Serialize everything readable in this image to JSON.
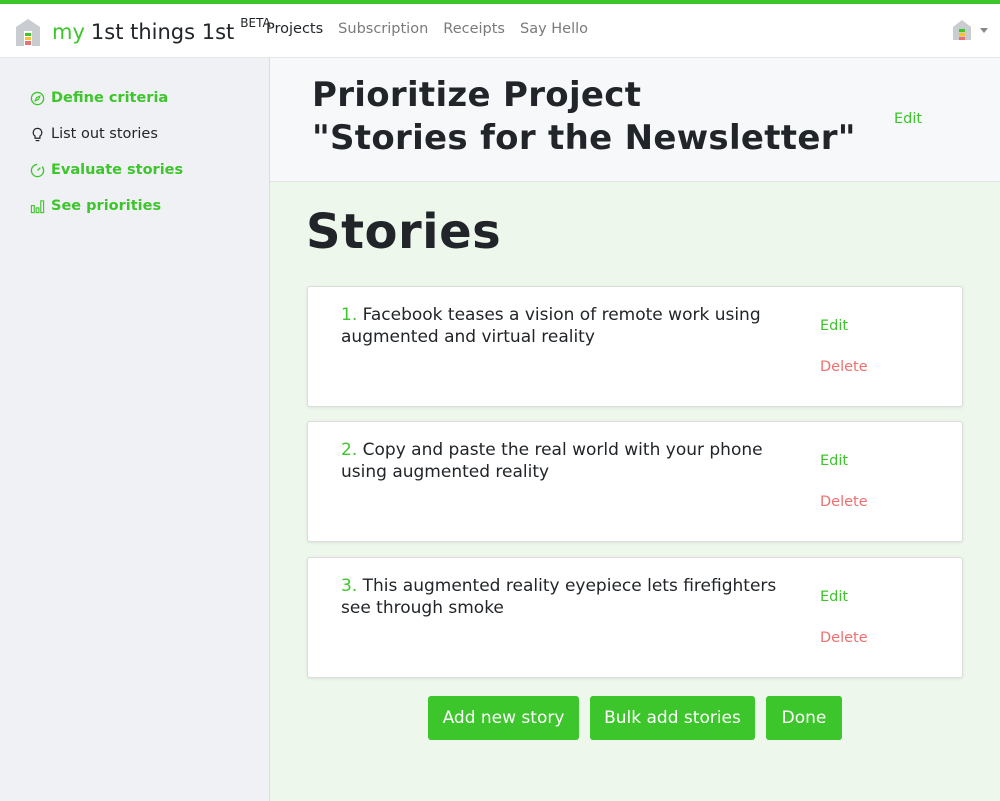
{
  "brand": {
    "my": "my",
    "name": "1st things 1st",
    "badge": "BETA"
  },
  "nav": {
    "links": [
      "Projects",
      "Subscription",
      "Receipts",
      "Say Hello"
    ],
    "active": "Projects"
  },
  "sidebar": {
    "items": [
      {
        "label": "Define criteria",
        "icon": "compass-icon"
      },
      {
        "label": "List out stories",
        "icon": "lightbulb-icon"
      },
      {
        "label": "Evaluate stories",
        "icon": "gauge-icon"
      },
      {
        "label": "See priorities",
        "icon": "bar-chart-icon"
      }
    ]
  },
  "project": {
    "title_line1": "Prioritize Project",
    "title_line2": "\"Stories for the Newsletter\"",
    "edit_label": "Edit"
  },
  "stories": {
    "title": "Stories",
    "items": [
      {
        "num": "1.",
        "text": "Facebook teases a vision of remote work using augmented and virtual reality",
        "edit": "Edit",
        "delete": "Delete"
      },
      {
        "num": "2.",
        "text": "Copy and paste the real world with your phone using augmented reality",
        "edit": "Edit",
        "delete": "Delete"
      },
      {
        "num": "3.",
        "text": "This augmented reality eyepiece lets firefighters see through smoke",
        "edit": "Edit",
        "delete": "Delete"
      }
    ]
  },
  "actions": {
    "add": "Add new story",
    "bulk": "Bulk add stories",
    "done": "Done"
  },
  "colors": {
    "accent": "#3cc62b",
    "danger": "#ee6f6f",
    "main_bg": "#eef7ec",
    "sidebar_bg": "#f0f1f4"
  }
}
